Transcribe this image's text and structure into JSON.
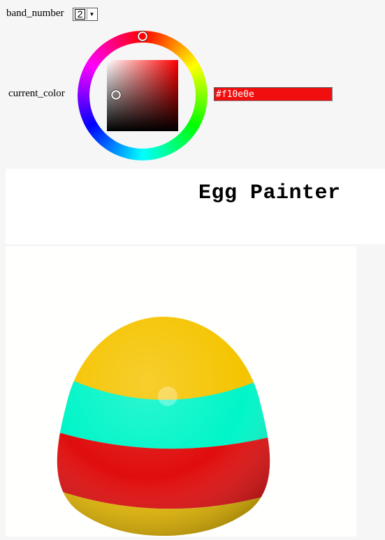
{
  "controls": {
    "band_label": "band_number",
    "band_value": "2",
    "color_label": "current_color",
    "color_hex": "#f10e0e"
  },
  "header": {
    "title": "Egg Painter"
  },
  "icons": {
    "dropdown": "chevron-down-icon"
  },
  "colors": {
    "selected": "#f10e0e",
    "picker_hue": "#ff0000",
    "band_top": "#f5c400",
    "band_1": "#00f5c8",
    "band_2": "#e00d0d",
    "band_bottom": "#e6b800"
  }
}
